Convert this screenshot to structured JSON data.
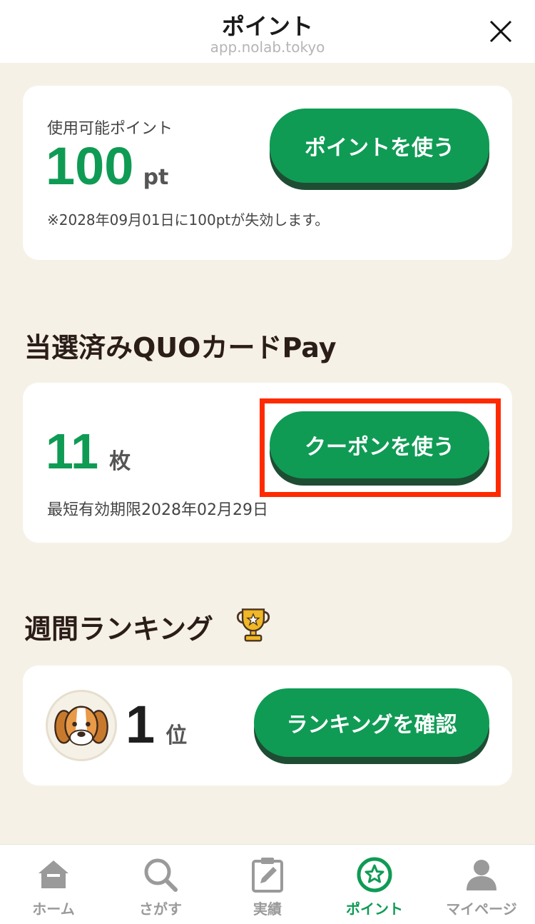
{
  "header": {
    "title": "ポイント",
    "url": "app.nolab.tokyo"
  },
  "points": {
    "label": "使用可能ポイント",
    "value": "100",
    "unit": "pt",
    "expiry_note": "※2028年09月01日に100ptが失効します。",
    "button_label": "ポイントを使う"
  },
  "quo": {
    "section_title": "当選済みQUOカードPay",
    "count": "11",
    "unit": "枚",
    "expiry_note": "最短有効期限2028年02月29日",
    "button_label": "クーポンを使う"
  },
  "ranking": {
    "section_title": "週間ランキング",
    "rank": "1",
    "unit": "位",
    "button_label": "ランキングを確認"
  },
  "tabbar": {
    "items": [
      {
        "label": "ホーム",
        "icon": "home-icon"
      },
      {
        "label": "さがす",
        "icon": "search-icon"
      },
      {
        "label": "実績",
        "icon": "clipboard-edit-icon"
      },
      {
        "label": "ポイント",
        "icon": "star-circle-icon",
        "active": true
      },
      {
        "label": "マイページ",
        "icon": "user-icon"
      }
    ]
  },
  "colors": {
    "accent": "#0f9b54",
    "button_shadow": "#1e4d33",
    "background": "#f6f1e6",
    "highlight": "#ff2a00"
  }
}
